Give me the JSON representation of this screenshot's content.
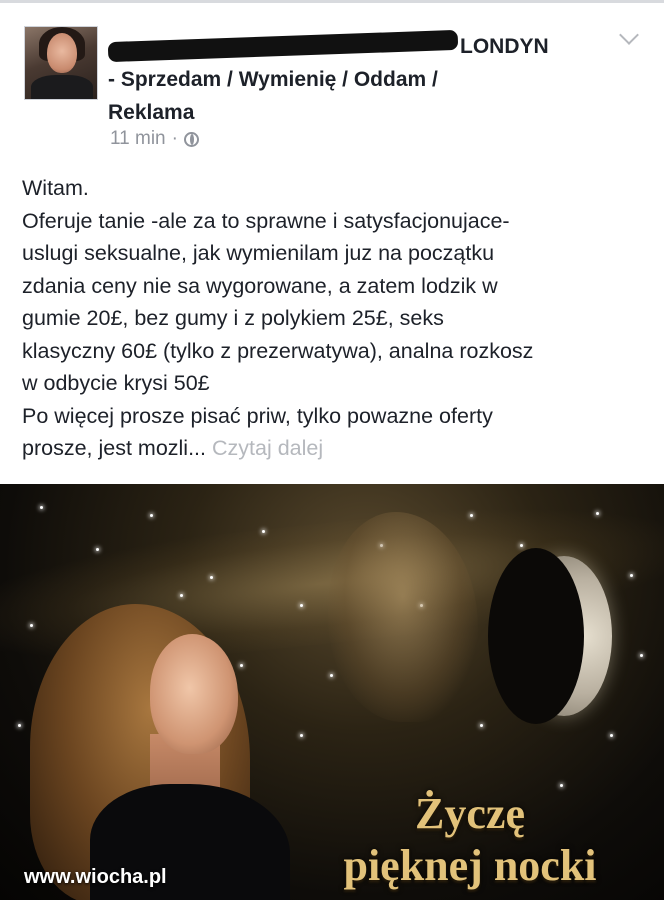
{
  "post": {
    "author_visible_suffix": "LONDYN",
    "author_rest_line1": "- Sprzedam / Wymienię / Oddam /",
    "author_rest_line2": "Reklama",
    "timestamp": "11 min",
    "separator": "·",
    "privacy_icon": "globe-icon",
    "menu_icon": "chevron-down-icon"
  },
  "body": {
    "line1": "Witam.",
    "line2": "Oferuje tanie -ale za to sprawne i satysfacjonujace-",
    "line3": "uslugi seksualne,  jak wymienilam juz na początku",
    "line4": "zdania ceny nie sa wygorowane,  a zatem lodzik w",
    "line5": "gumie 20£,  bez gumy i z polykiem 25£,  seks",
    "line6": "klasyczny 60£ (tylko z prezerwatywa),  analna rozkosz",
    "line7": "w odbycie krysi 50£",
    "line8": "Po więcej prosze pisać priw,  tylko powazne oferty",
    "line9_prefix": "prosze,  jest mozli...",
    "read_more": "Czytaj dalej"
  },
  "image": {
    "caption_line1": "Życzę",
    "caption_line2": "pięknej nocki",
    "watermark": "www.wiocha.pl"
  }
}
